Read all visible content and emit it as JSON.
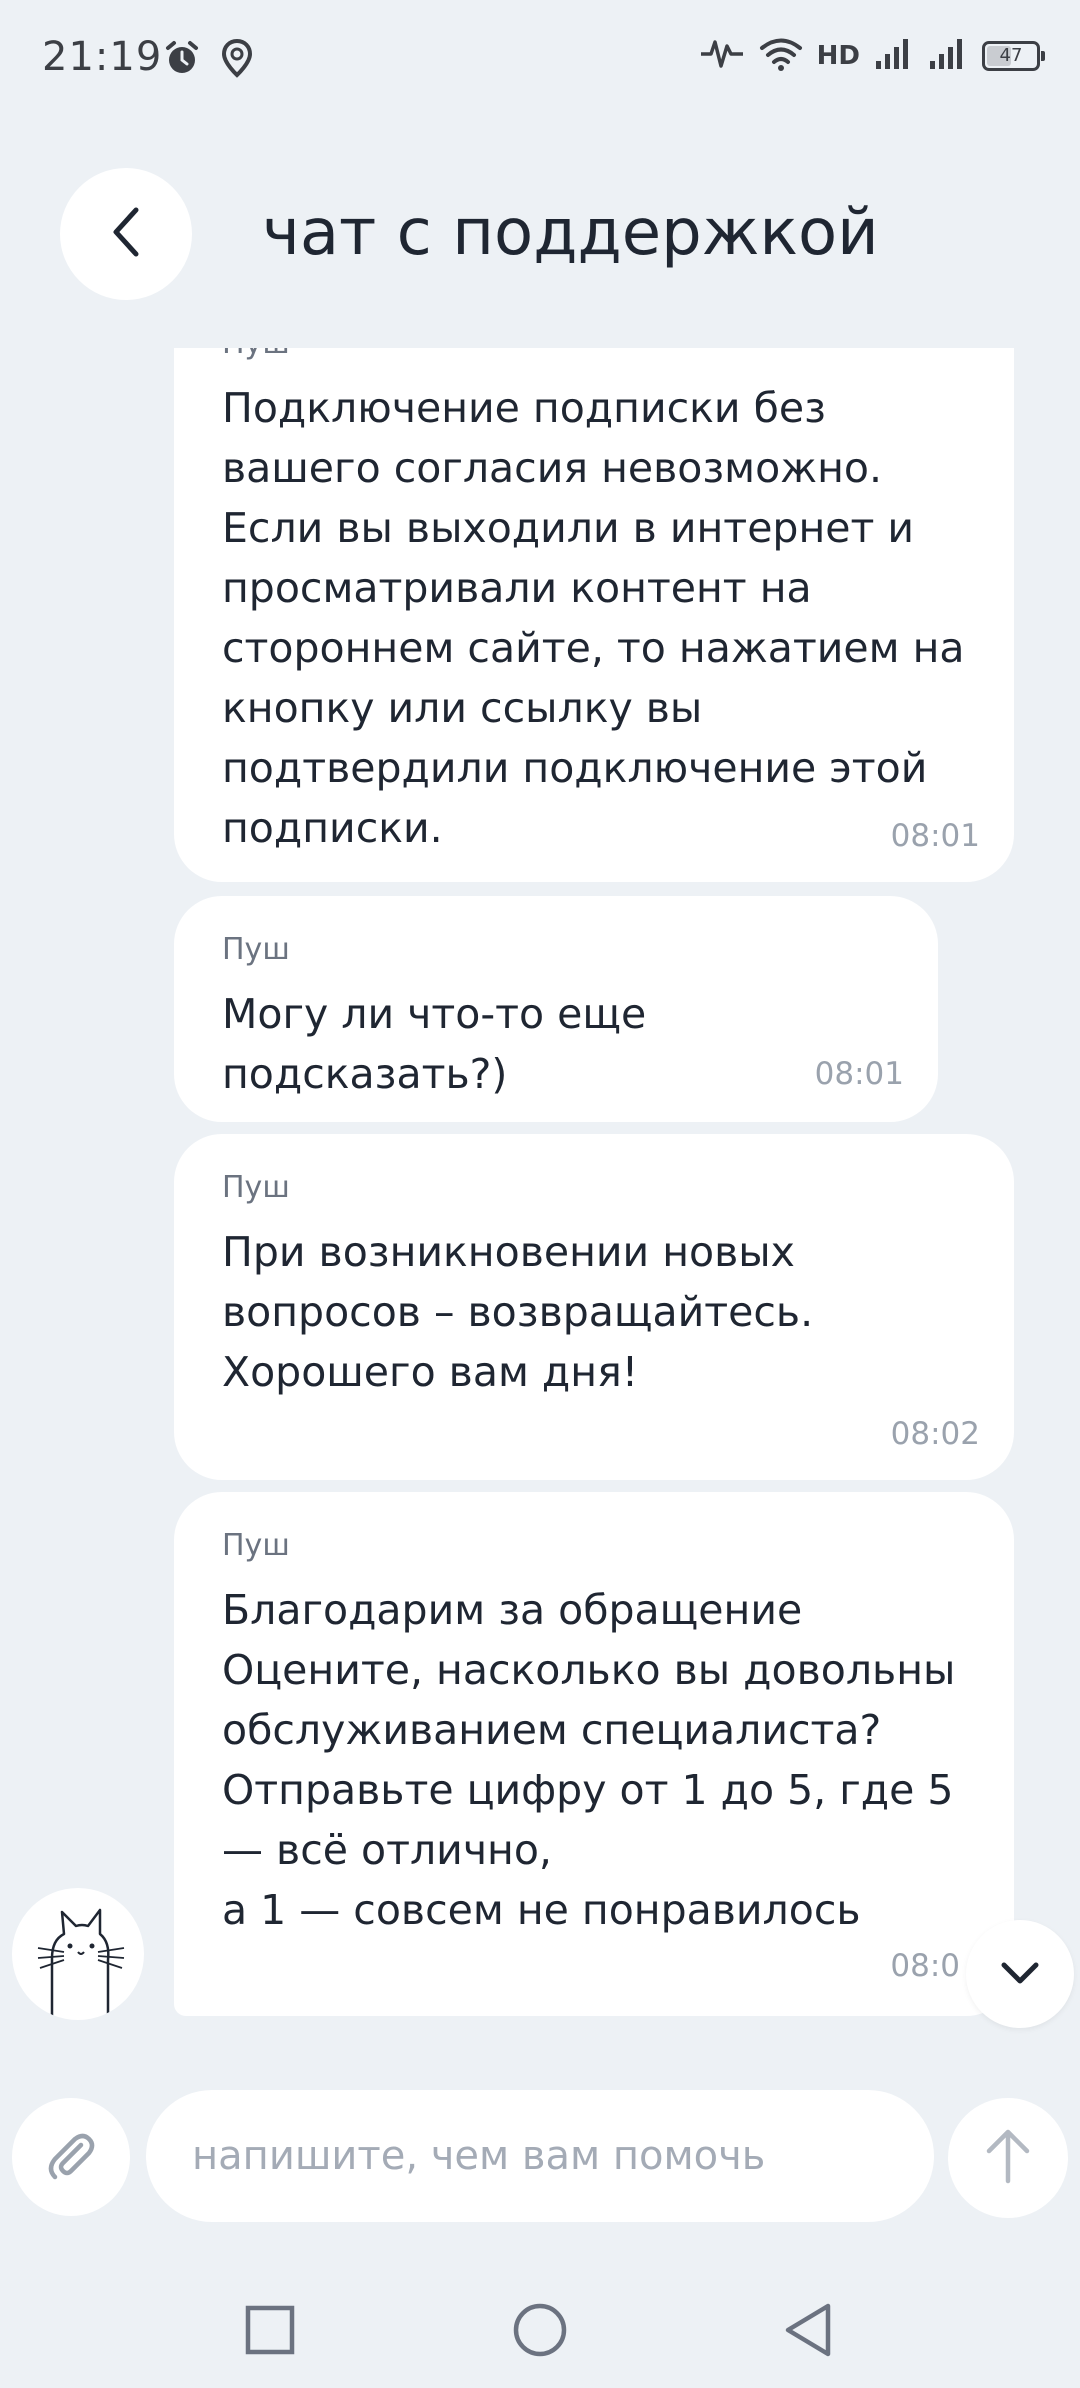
{
  "status_bar": {
    "time": "21:19",
    "network_label": "HD",
    "battery_level": "47"
  },
  "header": {
    "title": "чат с поддержкой",
    "back_icon": "chevron-left-icon"
  },
  "messages": [
    {
      "sender": "Пуш",
      "text": "Подключение подписки без вашего согласия невозможно.\nЕсли вы выходили в интернет и просматривали контент на стороннем сайте, то нажатием на кнопку или ссылку вы подтвердили подключение этой подписки.",
      "time": "08:01"
    },
    {
      "sender": "Пуш",
      "text": "Могу ли что-то еще подсказать?)",
      "time": "08:01"
    },
    {
      "sender": "Пуш",
      "text": "При возникновении новых вопросов – возвращайтесь. Хорошего вам дня!",
      "time": "08:02"
    },
    {
      "sender": "Пуш",
      "text": "Благодарим за обращение\nОцените, насколько вы довольны обслуживанием специалиста?\nОтправьте цифру от 1 до 5, где 5 — всё отлично,\nа 1 — совсем не понравилось",
      "time": "08:0"
    }
  ],
  "composer": {
    "placeholder": "напишите, чем вам помочь",
    "value": ""
  },
  "colors": {
    "background": "#edf1f5",
    "bubble": "#ffffff",
    "text": "#1f2632",
    "muted": "#9aa2ad"
  }
}
